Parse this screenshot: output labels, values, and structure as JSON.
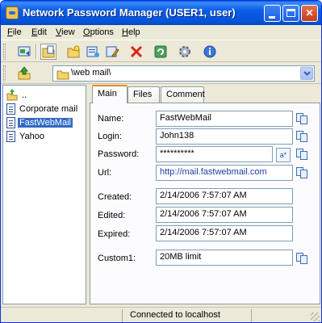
{
  "window": {
    "title": "Network Password Manager (USER1, user)",
    "accent_color": "#0a5ce8",
    "close_color": "#c23d1a"
  },
  "menu": {
    "items": [
      "File",
      "Edit",
      "View",
      "Options",
      "Help"
    ],
    "mnemonics": [
      "F",
      "E",
      "V",
      "O",
      "H"
    ],
    "rests": [
      "ile",
      "dit",
      "iew",
      "ptions",
      "elp"
    ]
  },
  "toolbar": {
    "icons": [
      "refresh-icon",
      "new-folder-view-icon",
      "new-folder-icon",
      "add-record-icon",
      "edit-record-icon",
      "delete-icon",
      "sync-icon",
      "settings-icon",
      "help-icon"
    ]
  },
  "path": {
    "value": "\\web mail\\"
  },
  "tree": {
    "items": [
      {
        "label": "..",
        "icon": "up-folder-icon"
      },
      {
        "label": "Corporate mail",
        "icon": "document-icon"
      },
      {
        "label": "FastWebMail",
        "icon": "document-icon",
        "selected": true
      },
      {
        "label": "Yahoo",
        "icon": "document-icon"
      }
    ]
  },
  "tabs": [
    "Main",
    "Files",
    "Comment"
  ],
  "fields": {
    "name_label": "Name:",
    "name_value": "FastWebMail",
    "login_label": "Login:",
    "login_value": "John138",
    "password_label": "Password:",
    "password_value": "**********",
    "show_password_label": "a*",
    "url_label": "Url:",
    "url_value": "http://mail.fastwebmail.com",
    "created_label": "Created:",
    "created_value": "2/14/2006  7:57:07 AM",
    "edited_label": "Edited:",
    "edited_value": "2/14/2006  7:57:07 AM",
    "expired_label": "Expired:",
    "expired_value": "2/14/2006  7:57:07 AM",
    "custom1_label": "Custom1:",
    "custom1_value": "20MB limit"
  },
  "status": {
    "text": "Connected to localhost"
  }
}
